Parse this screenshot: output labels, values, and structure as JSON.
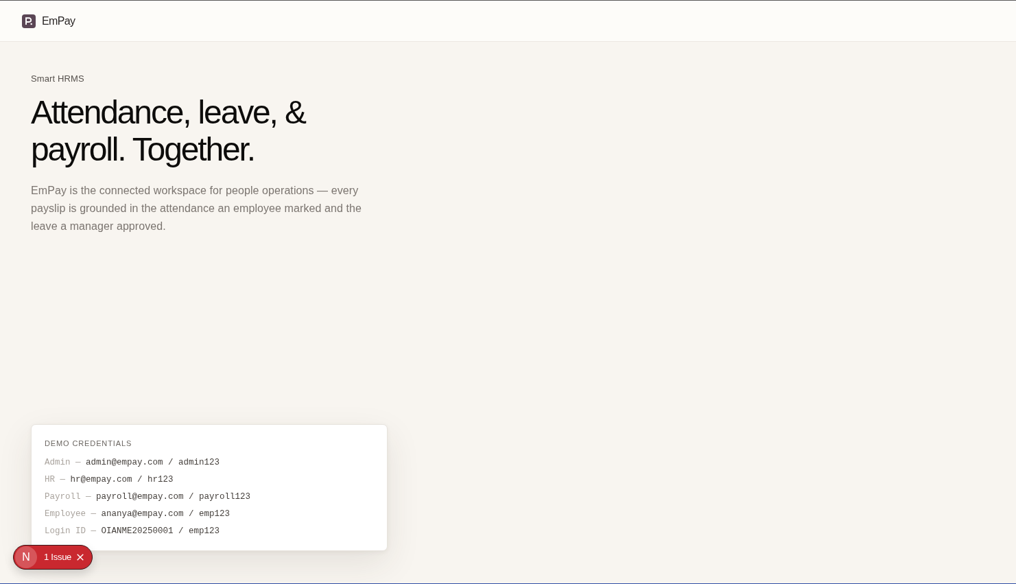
{
  "header": {
    "brand": "EmPay"
  },
  "hero": {
    "eyebrow": "Smart HRMS",
    "title": "Attendance, leave, & payroll. Together.",
    "description": "EmPay is the connected workspace for people operations — every payslip is grounded in the attendance an employee marked and the leave a manager approved."
  },
  "demo_credentials": {
    "title": "DEMO CREDENTIALS",
    "rows": [
      {
        "role": "Admin",
        "separator": "—",
        "login": "admin@empay.com / admin123"
      },
      {
        "role": "HR",
        "separator": "—",
        "login": "hr@empay.com / hr123"
      },
      {
        "role": "Payroll",
        "separator": "—",
        "login": "payroll@empay.com / payroll123"
      },
      {
        "role": "Employee",
        "separator": "—",
        "login": "ananya@empay.com / emp123"
      },
      {
        "role": "Login ID",
        "separator": "—",
        "login": "OIANME20250001 / emp123"
      }
    ]
  },
  "issue_badge": {
    "logo_letter": "N",
    "label": "1 Issue"
  }
}
